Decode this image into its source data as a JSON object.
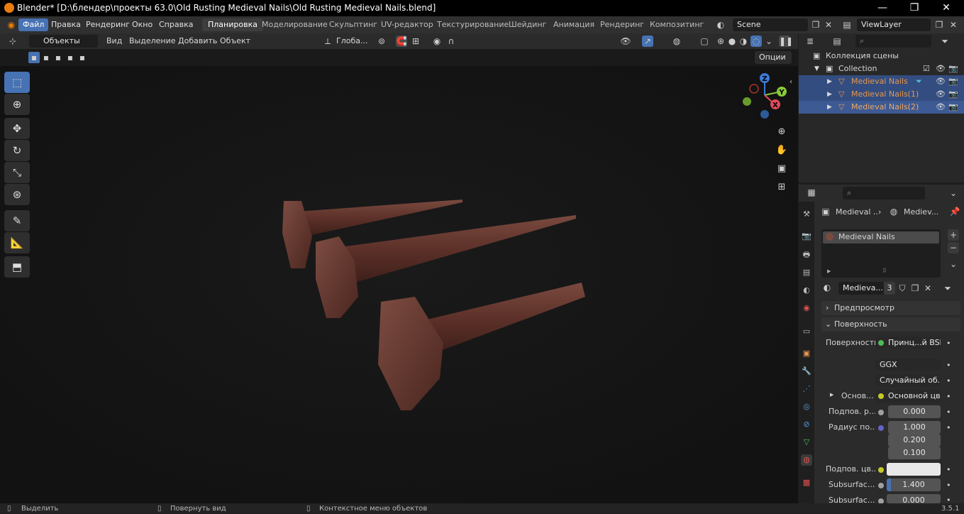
{
  "window": {
    "title": "Blender* [D:\\блендер\\проекты 63.0\\Old Rusting Medieval Nails\\Old Rusting Medieval Nails.blend]"
  },
  "menus": [
    "Файл",
    "Правка",
    "Рендеринг",
    "Окно",
    "Справка"
  ],
  "workspaces": [
    "Планировка",
    "Моделирование",
    "Скульптинг",
    "UV-редактор",
    "Текстурирование",
    "Шейдинг",
    "Анимация",
    "Рендеринг",
    "Композитинг"
  ],
  "scene": {
    "name": "Scene",
    "view_layer": "ViewLayer"
  },
  "viewport_header": {
    "mode": "Объекты",
    "view": "Вид",
    "select": "Выделение",
    "add": "Добавить",
    "object": "Объект",
    "transform": "Глоба...",
    "options": "Опции"
  },
  "gizmo": {
    "x": "X",
    "y": "Y",
    "z": "Z"
  },
  "outliner": {
    "root": "Коллекция сцены",
    "collection": "Collection",
    "items": [
      {
        "name": "Medieval Nails"
      },
      {
        "name": "Medieval Nails(1)"
      },
      {
        "name": "Medieval Nails(2)"
      }
    ]
  },
  "properties": {
    "breadcrumb": [
      "Medieval ...",
      "Mediev..."
    ],
    "slot": "Medieval Nails",
    "material": {
      "name": "Medieva...",
      "users": "3"
    },
    "panels": {
      "preview": "Предпросмотр",
      "surface": "Поверхность"
    },
    "rows": {
      "surface_label": "Поверхность",
      "surface_value": "Принц...й BSDF",
      "dist": "GGX",
      "ss_method": "Случайный об...",
      "base_label": "Основ...",
      "base_value": "Основной цвет",
      "sub_label": "Подпов. р...",
      "sub_value": "0.000",
      "radius_label": "Радиус по...",
      "r1": "1.000",
      "r2": "0.200",
      "r3": "0.100",
      "subcol_label": "Подпов. цв...",
      "ior_label": "Subsurfac...",
      "ior_value": "1.400",
      "aniso_label": "Subsurfac...",
      "aniso_value": "0.000"
    }
  },
  "status": {
    "select": "Выделить",
    "rotate": "Повернуть вид",
    "context": "Контекстное меню объектов",
    "version": "3.5.1"
  },
  "colors": {
    "accent": "#4772b3",
    "object_orange": "#e8964a",
    "selected_row": "#334d80",
    "rust": "#6b3a30"
  }
}
